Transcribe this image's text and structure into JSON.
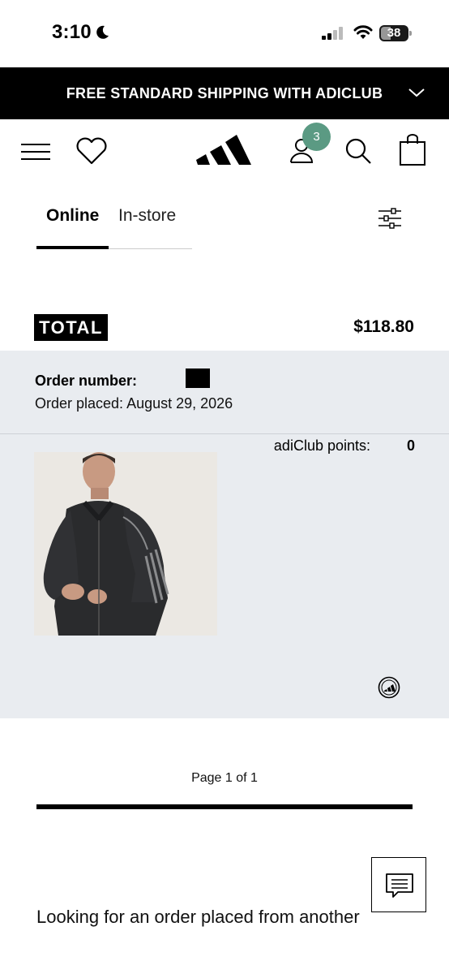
{
  "status_bar": {
    "time": "3:10",
    "battery": "38"
  },
  "promo": {
    "text": "FREE STANDARD SHIPPING WITH ADICLUB"
  },
  "header": {
    "account_badge_count": "3"
  },
  "tabs": [
    {
      "label": "Online",
      "active": true
    },
    {
      "label": "In-store",
      "active": false
    }
  ],
  "total": {
    "label": "TOTAL",
    "amount": "$118.80"
  },
  "order": {
    "number_label": "Order number:",
    "placed": "Order placed: August 29, 2026"
  },
  "points": {
    "label": "adiClub points:",
    "value": "0"
  },
  "pagination": {
    "text": "Page 1 of 1"
  },
  "footer": {
    "another_order_text": "Looking for an order placed from another"
  },
  "colors": {
    "badge_green": "#5b9a83",
    "panel_bg": "#e9ecf0",
    "promo_bg": "#000000"
  },
  "icons": [
    "moon-icon",
    "signal-icon",
    "wifi-icon",
    "battery-icon",
    "chevron-down-icon",
    "menu-icon",
    "heart-icon",
    "adidas-logo",
    "account-icon",
    "search-icon",
    "bag-icon",
    "filter-icon",
    "adiclub-points-icon",
    "chat-icon"
  ]
}
